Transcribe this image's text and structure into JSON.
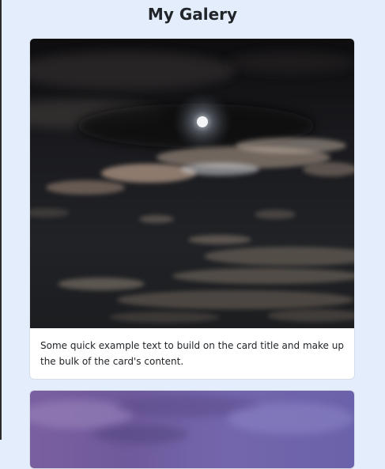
{
  "page": {
    "title": "My Galery"
  },
  "cards": [
    {
      "image": "night-sky-moon-clouds-photo",
      "text": "Some quick example text to build on the card title and make up the bulk of the card's content."
    },
    {
      "image": "purple-cloudy-sky-photo"
    }
  ],
  "colors": {
    "background": "#e3edfc",
    "card_background": "#ffffff",
    "text": "#212529"
  }
}
